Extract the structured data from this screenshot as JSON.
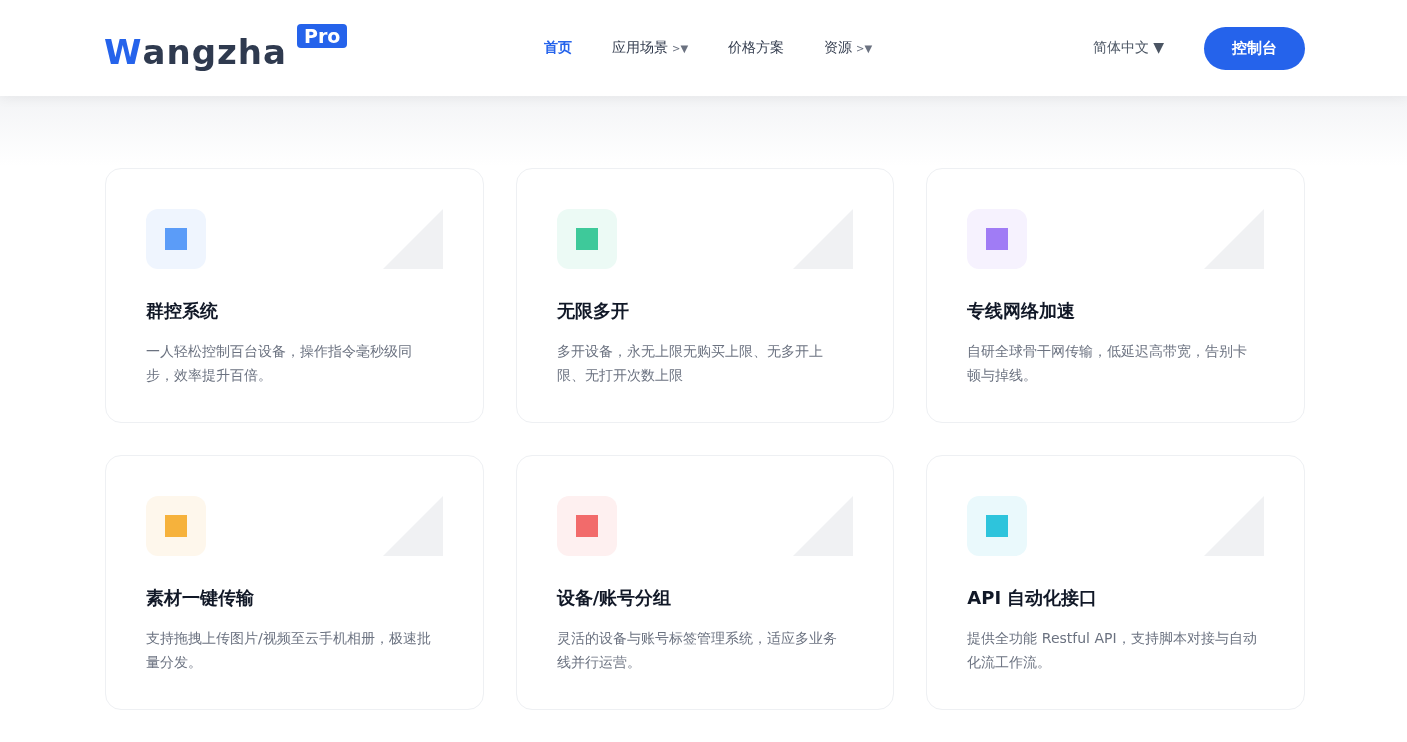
{
  "header": {
    "logo": {
      "text": "Wangzha",
      "badge": "Pro"
    },
    "nav": [
      {
        "label": "首页",
        "selected": true
      },
      {
        "label": "应用场景",
        "selected": false,
        "caret": ">▼"
      },
      {
        "label": "价格方案",
        "selected": false
      },
      {
        "label": "资源",
        "selected": false,
        "caret": ">▼"
      }
    ],
    "language": {
      "label": "简体中文",
      "caret": "▼"
    },
    "console_button": "控制台"
  },
  "features": [
    {
      "title": "群控系统",
      "description": "一人轻松控制百台设备，操作指令毫秒级同步，效率提升百倍。",
      "color": "#5b9cf8"
    },
    {
      "title": "无限多开",
      "description": "多开设备，永无上限无购买上限、无多开上限、无打开次数上限",
      "color": "#3ec99a"
    },
    {
      "title": "专线网络加速",
      "description": "自研全球骨干网传输，低延迟高带宽，告别卡顿与掉线。",
      "color": "#a07cf5"
    },
    {
      "title": "素材一键传输",
      "description": "支持拖拽上传图片/视频至云手机相册，极速批量分发。",
      "color": "#f6b23c"
    },
    {
      "title": "设备/账号分组",
      "description": "灵活的设备与账号标签管理系统，适应多业务线并行运营。",
      "color": "#f26b6b"
    },
    {
      "title": "API 自动化接口",
      "description": "提供全功能 Restful API，支持脚本对接与自动化流工作流。",
      "color": "#2ec4dc"
    }
  ]
}
